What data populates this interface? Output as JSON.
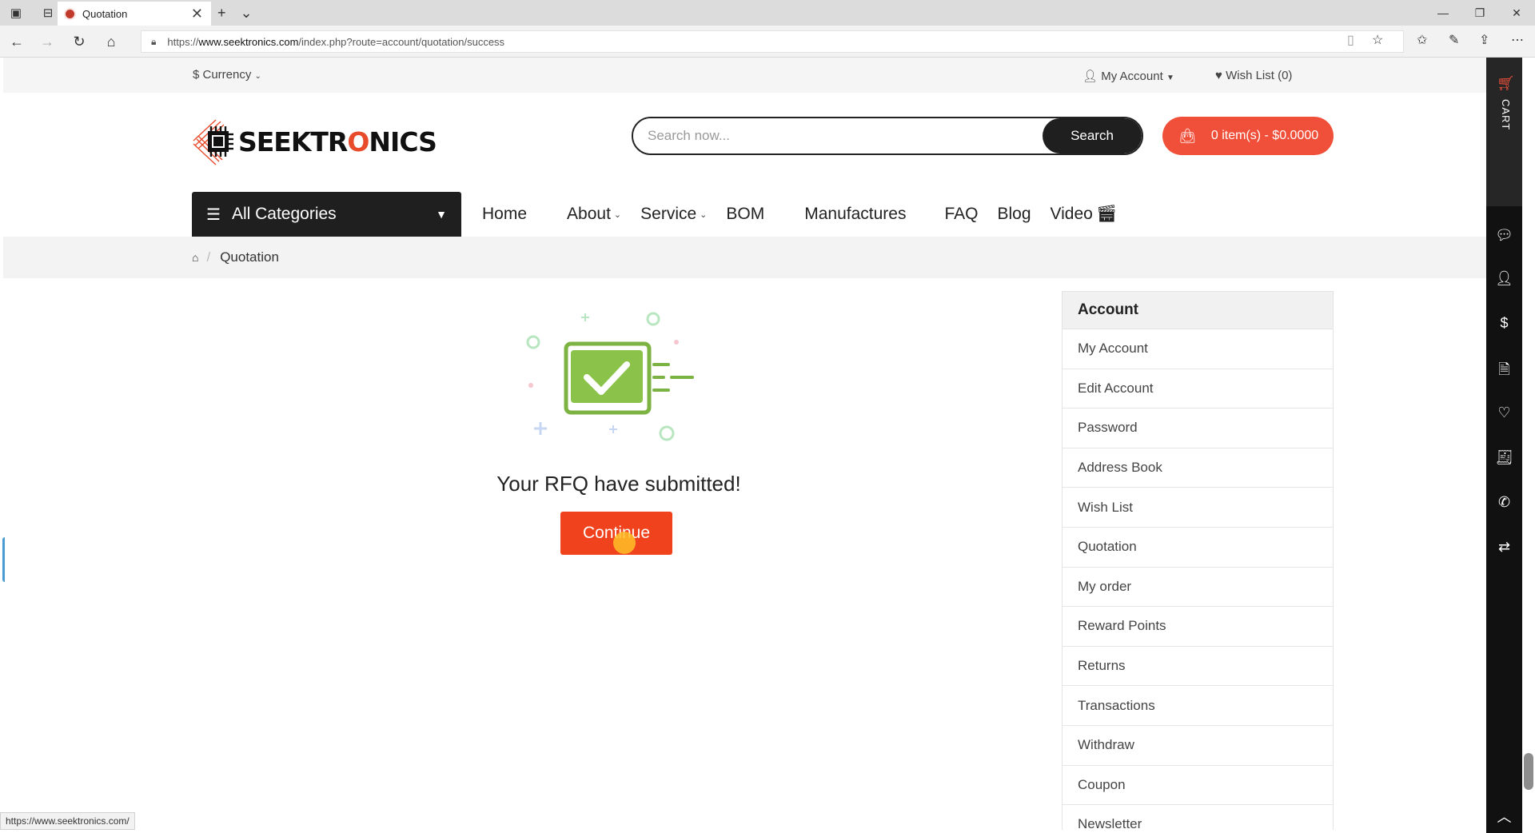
{
  "browser": {
    "tab_title": "Quotation",
    "url_prefix": "https://",
    "url_host": "www.seektronics.com",
    "url_path": "/index.php?route=account/quotation/success",
    "status_url": "https://www.seektronics.com/"
  },
  "topbar": {
    "currency": "$ Currency",
    "my_account": "My Account",
    "wish_list": "Wish List (0)"
  },
  "logo": {
    "text_before": "SEEKTR",
    "text_o": "O",
    "text_after": "NICS"
  },
  "search": {
    "placeholder": "Search now...",
    "button": "Search"
  },
  "cart": {
    "label": "0 item(s) - $0.0000"
  },
  "nav": {
    "all_categories": "All Categories",
    "items": [
      "Home",
      "About",
      "Service",
      "BOM",
      "Manufactures",
      "FAQ",
      "Blog",
      "Video"
    ]
  },
  "breadcrumb": {
    "current": "Quotation"
  },
  "main": {
    "message": "Your RFQ have submitted!",
    "continue": "Continue"
  },
  "account_panel": {
    "title": "Account",
    "items": [
      "My Account",
      "Edit Account",
      "Password",
      "Address Book",
      "Wish List",
      "Quotation",
      "My order",
      "Reward Points",
      "Returns",
      "Transactions",
      "Withdraw",
      "Coupon",
      "Newsletter"
    ]
  },
  "sidebar": {
    "cart_label": "CART"
  },
  "colors": {
    "accent": "#f0503a",
    "continue": "#f0431d",
    "success_green": "#8bc34a",
    "dark": "#1f1f1f"
  }
}
